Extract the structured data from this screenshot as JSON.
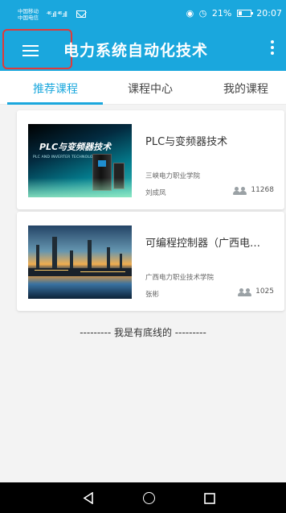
{
  "status_bar": {
    "carrier_1": "中国移动",
    "carrier_2": "中国电信",
    "signal_text": "⁴⁶.ıll ⁴⁶.ıll",
    "eye_glyph": "◉",
    "alarm_glyph": "◷",
    "battery_percent": "21%",
    "time": "20:07"
  },
  "app_bar": {
    "title": "电力系统自动化技术",
    "menu_icon": "menu-icon",
    "more_icon": "more-vertical-icon",
    "highlight_color": "#e03a3a",
    "background_color": "#1aa7dd"
  },
  "tabs": [
    {
      "label": "推荐课程",
      "active": true
    },
    {
      "label": "课程中心",
      "active": false
    },
    {
      "label": "我的课程",
      "active": false
    }
  ],
  "courses": [
    {
      "title": "PLC与变频器技术",
      "school": "三峡电力职业学院",
      "teacher": "刘成凤",
      "count": "11268",
      "thumb_text": "PLC与变频器技术",
      "thumb_subtext": "PLC AND INVERTER TECHNOLOGY"
    },
    {
      "title": "可编程控制器（广西电…",
      "school": "广西电力职业技术学院",
      "teacher": "张彬",
      "count": "1025"
    }
  ],
  "footer_text": "---------  我是有底线的  ---------",
  "navigation": {
    "back_icon": "back-triangle-icon",
    "home_icon": "home-circle-icon",
    "recent_icon": "recent-square-icon"
  }
}
